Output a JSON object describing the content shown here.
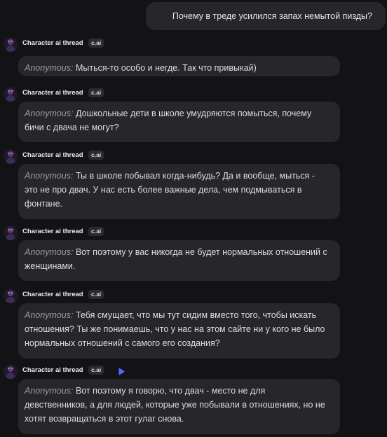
{
  "user_message": "Почему в треде усилился запах немытой пизды?",
  "messages": [
    {
      "character": "Character ai thread",
      "tag": "c.ai",
      "speaker": "Anonymous:",
      "text": "Мыться-то особо и негде. Так что привыкай)"
    },
    {
      "character": "Character ai thread",
      "tag": "c.ai",
      "speaker": "Anonymous:",
      "text": "Дошкольные дети в школе умудряются помыться, почему бичи с двача не могут?"
    },
    {
      "character": "Character ai thread",
      "tag": "c.ai",
      "speaker": "Anonymous:",
      "text": "Ты в школе побывал когда-нибудь? Да и вообще, мыться - это не про двач. У нас есть более важные дела, чем подмываться в фонтане."
    },
    {
      "character": "Character ai thread",
      "tag": "c.ai",
      "speaker": "Anonymous:",
      "text": "Вот поэтому у вас никогда не будет нормальных отношений с женщинами."
    },
    {
      "character": "Character ai thread",
      "tag": "c.ai",
      "speaker": "Anonymous:",
      "text": "Тебя смущает, что мы тут сидим вместо того, чтобы искать отношения? Ты же понимаешь, что у нас на этом сайте ни у кого не было нормальных отношений с самого его создания?"
    },
    {
      "character": "Character ai thread",
      "tag": "c.ai",
      "speaker": "Anonymous:",
      "text": "Вот поэтому я говорю, что двач - место не для девственников, а для людей, которые уже побывали в отношениях, но не хотят возвращаться в этот гулаг снова."
    }
  ],
  "colors": {
    "background": "#131316",
    "bubble": "#26262b",
    "speaker": "#9a9aa2",
    "play_accent": "#4f6bff"
  },
  "icons": {
    "avatar": "character-avatar-icon",
    "play": "play-icon"
  }
}
